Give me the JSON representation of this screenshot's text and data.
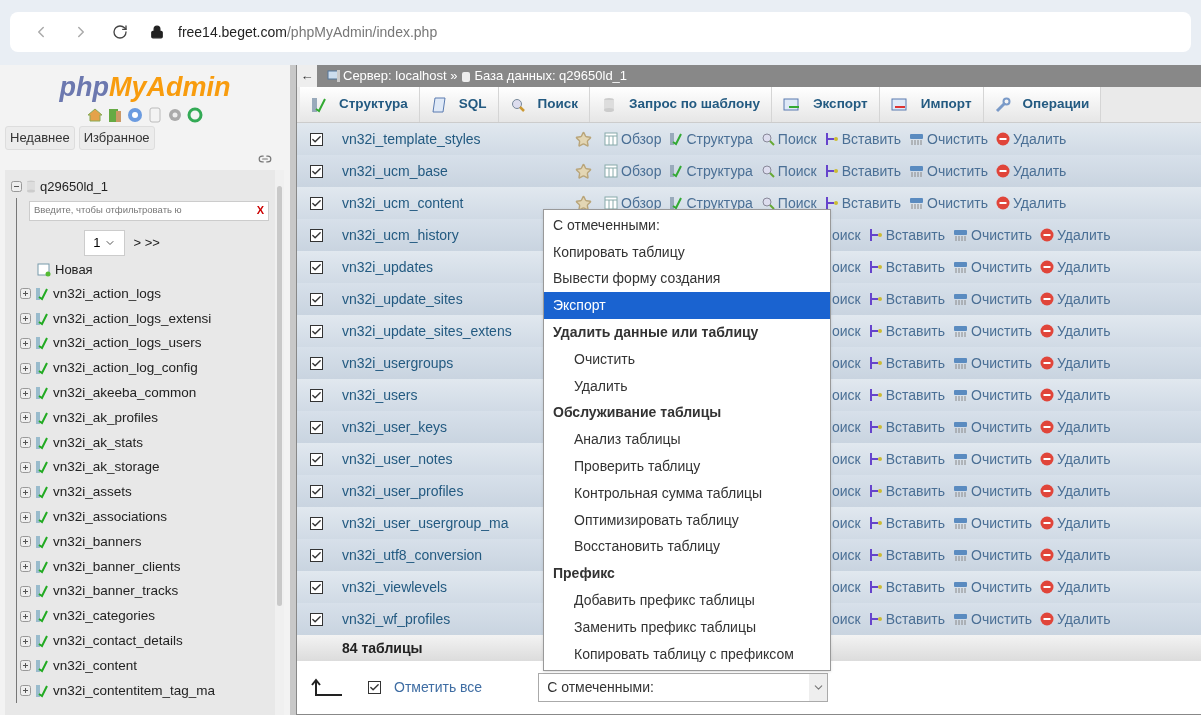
{
  "browser": {
    "url": {
      "host": "free14.beget.com",
      "path": "/phpMyAdmin/index.php"
    }
  },
  "sidebar": {
    "logo": [
      {
        "text": "php",
        "color": "#6c78af"
      },
      {
        "text": "MyAdmin",
        "color": "#f89c0e"
      }
    ],
    "tabs": [
      "Недавнее",
      "Избранное"
    ],
    "tree": {
      "name": "q29650ld_1",
      "expanded": true,
      "filter_placeholder": "Введите, чтобы отфильтровать ю",
      "clear": "X",
      "page": "1",
      "pager": "> >>",
      "new_item": "Новая",
      "children": [
        {
          "name": "vn32i_action_logs",
          "expanded": false
        },
        {
          "name": "vn32i_action_logs_extensi",
          "expanded": false
        },
        {
          "name": "vn32i_action_logs_users",
          "expanded": false
        },
        {
          "name": "vn32i_action_log_config",
          "expanded": false
        },
        {
          "name": "vn32i_akeeba_common",
          "expanded": false
        },
        {
          "name": "vn32i_ak_profiles",
          "expanded": false
        },
        {
          "name": "vn32i_ak_stats",
          "expanded": false
        },
        {
          "name": "vn32i_ak_storage",
          "expanded": false
        },
        {
          "name": "vn32i_assets",
          "expanded": false
        },
        {
          "name": "vn32i_associations",
          "expanded": false
        },
        {
          "name": "vn32i_banners",
          "expanded": false
        },
        {
          "name": "vn32i_banner_clients",
          "expanded": false
        },
        {
          "name": "vn32i_banner_tracks",
          "expanded": false
        },
        {
          "name": "vn32i_categories",
          "expanded": false
        },
        {
          "name": "vn32i_contact_details",
          "expanded": false
        },
        {
          "name": "vn32i_content",
          "expanded": false
        },
        {
          "name": "vn32i_contentitem_tag_ma",
          "expanded": false
        }
      ]
    }
  },
  "breadcrumb": {
    "back": "←",
    "server": "Сервер: localhost »",
    "database": "База данных: q29650ld_1"
  },
  "tabs": [
    {
      "kind": "structure",
      "label": "Структура"
    },
    {
      "kind": "sql",
      "label": "SQL"
    },
    {
      "kind": "search",
      "label": "Поиск"
    },
    {
      "kind": "query",
      "label": "Запрос по шаблону"
    },
    {
      "kind": "export",
      "label": "Экспорт"
    },
    {
      "kind": "import",
      "label": "Импорт"
    },
    {
      "kind": "operations",
      "label": "Операции"
    }
  ],
  "rows": [
    {
      "kind": "full",
      "name": "vn32i_template_styles",
      "checked": true,
      "actions": [
        {
          "kind": "browse",
          "label": "Обзор"
        },
        {
          "kind": "structure",
          "label": "Структура"
        },
        {
          "kind": "search",
          "label": "Поиск"
        },
        {
          "kind": "insert",
          "label": "Вставить"
        },
        {
          "kind": "empty",
          "label": "Очистить"
        },
        {
          "kind": "drop",
          "label": "Удалить"
        }
      ]
    },
    {
      "kind": "full",
      "name": "vn32i_ucm_base",
      "checked": true,
      "actions": [
        {
          "kind": "browse",
          "label": "Обзор"
        },
        {
          "kind": "structure",
          "label": "Структура"
        },
        {
          "kind": "search",
          "label": "Поиск"
        },
        {
          "kind": "insert",
          "label": "Вставить"
        },
        {
          "kind": "empty",
          "label": "Очистить"
        },
        {
          "kind": "drop",
          "label": "Удалить"
        }
      ]
    },
    {
      "kind": "full",
      "name": "vn32i_ucm_content",
      "checked": true,
      "actions": [
        {
          "kind": "browse",
          "label": "Обзор"
        },
        {
          "kind": "structure",
          "label": "Структура"
        },
        {
          "kind": "search",
          "label": "Поиск"
        },
        {
          "kind": "insert",
          "label": "Вставить"
        },
        {
          "kind": "empty",
          "label": "Очистить"
        },
        {
          "kind": "drop",
          "label": "Удалить"
        }
      ]
    },
    {
      "kind": "covered",
      "name": "vn32i_ucm_history",
      "checked": true,
      "actions": [
        {
          "kind": "fragment",
          "label": "оиск"
        },
        {
          "kind": "insert",
          "label": "Вставить"
        },
        {
          "kind": "empty",
          "label": "Очистить"
        },
        {
          "kind": "drop",
          "label": "Удалить"
        }
      ]
    },
    {
      "kind": "covered",
      "name": "vn32i_updates",
      "checked": true,
      "actions": [
        {
          "kind": "fragment",
          "label": "оиск"
        },
        {
          "kind": "insert",
          "label": "Вставить"
        },
        {
          "kind": "empty",
          "label": "Очистить"
        },
        {
          "kind": "drop",
          "label": "Удалить"
        }
      ]
    },
    {
      "kind": "covered",
      "name": "vn32i_update_sites",
      "checked": true,
      "actions": [
        {
          "kind": "fragment",
          "label": "оиск"
        },
        {
          "kind": "insert",
          "label": "Вставить"
        },
        {
          "kind": "empty",
          "label": "Очистить"
        },
        {
          "kind": "drop",
          "label": "Удалить"
        }
      ]
    },
    {
      "kind": "covered",
      "name": "vn32i_update_sites_extens",
      "checked": true,
      "actions": [
        {
          "kind": "fragment",
          "label": "оиск"
        },
        {
          "kind": "insert",
          "label": "Вставить"
        },
        {
          "kind": "empty",
          "label": "Очистить"
        },
        {
          "kind": "drop",
          "label": "Удалить"
        }
      ]
    },
    {
      "kind": "covered",
      "name": "vn32i_usergroups",
      "checked": true,
      "actions": [
        {
          "kind": "fragment",
          "label": "оиск"
        },
        {
          "kind": "insert",
          "label": "Вставить"
        },
        {
          "kind": "empty",
          "label": "Очистить"
        },
        {
          "kind": "drop",
          "label": "Удалить"
        }
      ]
    },
    {
      "kind": "covered",
      "name": "vn32i_users",
      "checked": true,
      "actions": [
        {
          "kind": "fragment",
          "label": "оиск"
        },
        {
          "kind": "insert",
          "label": "Вставить"
        },
        {
          "kind": "empty",
          "label": "Очистить"
        },
        {
          "kind": "drop",
          "label": "Удалить"
        }
      ]
    },
    {
      "kind": "covered",
      "name": "vn32i_user_keys",
      "checked": true,
      "actions": [
        {
          "kind": "fragment",
          "label": "оиск"
        },
        {
          "kind": "insert",
          "label": "Вставить"
        },
        {
          "kind": "empty",
          "label": "Очистить"
        },
        {
          "kind": "drop",
          "label": "Удалить"
        }
      ]
    },
    {
      "kind": "covered",
      "name": "vn32i_user_notes",
      "checked": true,
      "actions": [
        {
          "kind": "fragment",
          "label": "оиск"
        },
        {
          "kind": "insert",
          "label": "Вставить"
        },
        {
          "kind": "empty",
          "label": "Очистить"
        },
        {
          "kind": "drop",
          "label": "Удалить"
        }
      ]
    },
    {
      "kind": "covered",
      "name": "vn32i_user_profiles",
      "checked": true,
      "actions": [
        {
          "kind": "fragment",
          "label": "оиск"
        },
        {
          "kind": "insert",
          "label": "Вставить"
        },
        {
          "kind": "empty",
          "label": "Очистить"
        },
        {
          "kind": "drop",
          "label": "Удалить"
        }
      ]
    },
    {
      "kind": "covered",
      "name": "vn32i_user_usergroup_ma",
      "checked": true,
      "actions": [
        {
          "kind": "fragment",
          "label": "оиск"
        },
        {
          "kind": "insert",
          "label": "Вставить"
        },
        {
          "kind": "empty",
          "label": "Очистить"
        },
        {
          "kind": "drop",
          "label": "Удалить"
        }
      ]
    },
    {
      "kind": "covered",
      "name": "vn32i_utf8_conversion",
      "checked": true,
      "actions": [
        {
          "kind": "fragment",
          "label": "оиск"
        },
        {
          "kind": "insert",
          "label": "Вставить"
        },
        {
          "kind": "empty",
          "label": "Очистить"
        },
        {
          "kind": "drop",
          "label": "Удалить"
        }
      ]
    },
    {
      "kind": "covered",
      "name": "vn32i_viewlevels",
      "checked": true,
      "actions": [
        {
          "kind": "fragment",
          "label": "оиск"
        },
        {
          "kind": "insert",
          "label": "Вставить"
        },
        {
          "kind": "empty",
          "label": "Очистить"
        },
        {
          "kind": "drop",
          "label": "Удалить"
        }
      ]
    },
    {
      "kind": "covered",
      "name": "vn32i_wf_profiles",
      "checked": true,
      "actions": [
        {
          "kind": "fragment",
          "label": "оиск"
        },
        {
          "kind": "insert",
          "label": "Вставить"
        },
        {
          "kind": "empty",
          "label": "Очистить"
        },
        {
          "kind": "drop",
          "label": "Удалить"
        }
      ]
    }
  ],
  "summary": "84 таблицы",
  "footer": {
    "check_all": {
      "label": "Отметить все",
      "checked": true
    },
    "select_value": "С отмеченными:"
  },
  "menu": [
    {
      "kind": "option",
      "label": "С отмеченными:",
      "selected": false
    },
    {
      "kind": "option",
      "label": "Копировать таблицу",
      "selected": false
    },
    {
      "kind": "option",
      "label": "Вывести форму создания",
      "selected": false
    },
    {
      "kind": "option",
      "label": "Экспорт",
      "selected": true
    },
    {
      "kind": "group",
      "label": "Удалить данные или таблицу",
      "children": [
        {
          "label": "Очистить",
          "selected": false
        },
        {
          "label": "Удалить",
          "selected": false
        }
      ]
    },
    {
      "kind": "group",
      "label": "Обслуживание таблицы",
      "children": [
        {
          "label": "Анализ таблицы",
          "selected": false
        },
        {
          "label": "Проверить таблицу",
          "selected": false
        },
        {
          "label": "Контрольная сумма таблицы",
          "selected": false
        },
        {
          "label": "Оптимизировать таблицу",
          "selected": false
        },
        {
          "label": "Восстановить таблицу",
          "selected": false
        }
      ]
    },
    {
      "kind": "group",
      "label": "Префикс",
      "children": [
        {
          "label": "Добавить префикс таблицы",
          "selected": false
        },
        {
          "label": "Заменить префикс таблицы",
          "selected": false
        },
        {
          "label": "Копировать таблицу с префиксом",
          "selected": false
        }
      ]
    }
  ]
}
